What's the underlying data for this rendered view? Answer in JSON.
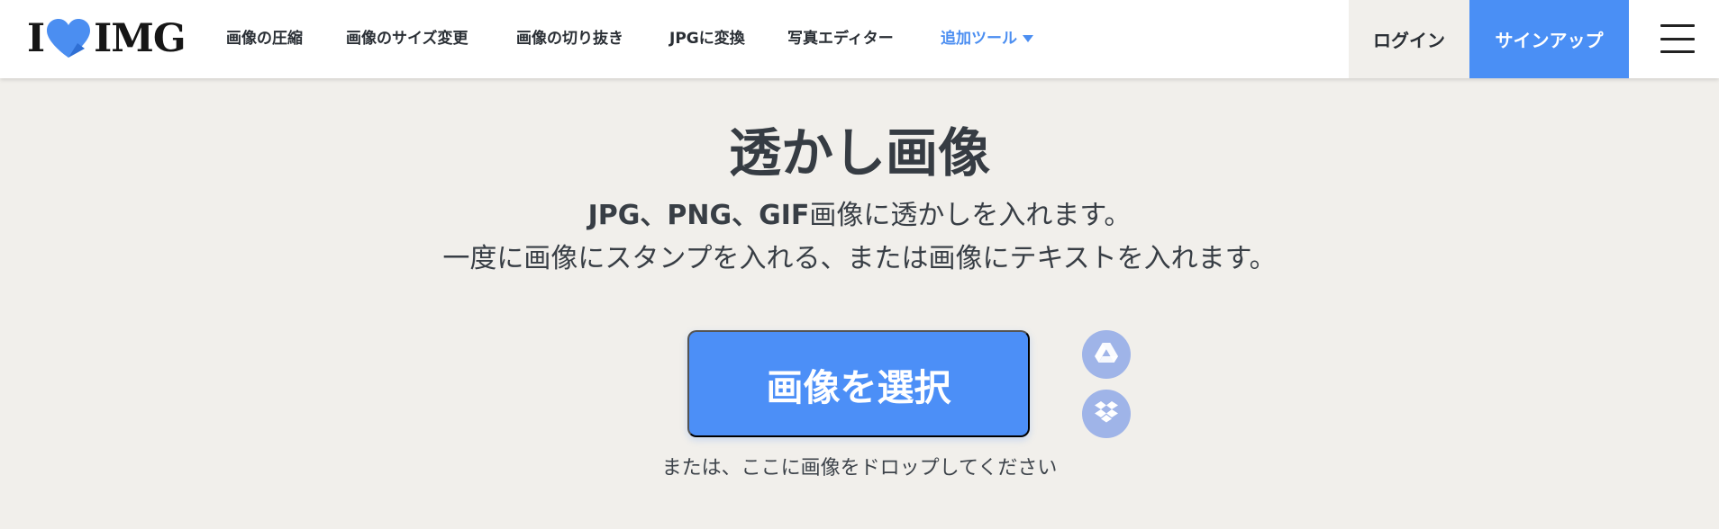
{
  "header": {
    "logo": {
      "left_text": "I",
      "right_text": "IMG",
      "heart_icon": "heart-icon",
      "brand_color": "#4b8ef1"
    },
    "nav": [
      {
        "label": "画像の圧縮"
      },
      {
        "label": "画像のサイズ変更"
      },
      {
        "label": "画像の切り抜き"
      },
      {
        "label": "JPGに変換"
      },
      {
        "label": "写真エディター"
      },
      {
        "label": "追加ツール",
        "icon": "caret-down-icon"
      }
    ],
    "login_label": "ログイン",
    "signup_label": "サインアップ",
    "menu_icon": "hamburger-menu-icon"
  },
  "main": {
    "title": "透かし画像",
    "subtitle_line1_bold": "JPG、PNG、GIF",
    "subtitle_line1_rest": "画像に透かしを入れます。",
    "subtitle_line2": "一度に画像にスタンプを入れる、または画像にテキストを入れます。",
    "select_button_label": "画像を選択",
    "cloud_buttons": [
      {
        "icon": "google-drive-icon"
      },
      {
        "icon": "dropbox-icon"
      }
    ],
    "drop_hint": "または、ここに画像をドロップしてください"
  },
  "colors": {
    "background": "#f1efeb",
    "accent": "#4c8ff7",
    "cloud_button": "#9fb4e8",
    "header": "#ffffff"
  }
}
